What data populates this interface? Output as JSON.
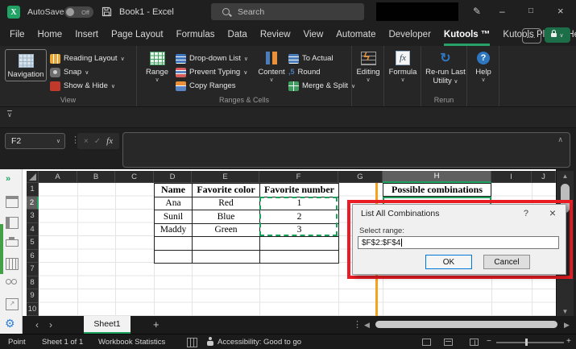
{
  "titlebar": {
    "autosave": "AutoSave",
    "autosave_state": "Off",
    "doc_title": "Book1 - Excel",
    "search_placeholder": "Search"
  },
  "tabs": {
    "items": [
      "File",
      "Home",
      "Insert",
      "Page Layout",
      "Formulas",
      "Data",
      "Review",
      "View",
      "Automate",
      "Developer",
      "Kutools ™",
      "Kutools Plus",
      "Help"
    ],
    "active": "Kutools ™"
  },
  "ribbon": {
    "navigation": "Navigation",
    "reading_layout": "Reading Layout",
    "snap": "Snap",
    "show_hide": "Show & Hide",
    "view_label": "View",
    "range": "Range",
    "dropdown_list": "Drop-down List",
    "prevent_typing": "Prevent Typing",
    "copy_ranges": "Copy Ranges",
    "content": "Content",
    "to_actual": "To Actual",
    "round": "Round",
    "round_icon": ",5",
    "merge_split": "Merge & Split",
    "ranges_cells_label": "Ranges & Cells",
    "editing": "Editing",
    "formula": "Formula",
    "rerun_last": "Re-run Last Utility",
    "rerun_label": "Rerun",
    "help": "Help"
  },
  "formula_bar": {
    "name_box": "F2"
  },
  "sheet": {
    "columns": [
      "A",
      "B",
      "C",
      "D",
      "E",
      "F",
      "G",
      "H",
      "I",
      "J"
    ],
    "rows": [
      "1",
      "2",
      "3",
      "4",
      "5",
      "6",
      "7",
      "8",
      "9",
      "10"
    ],
    "table": {
      "headers": [
        "Name",
        "Favorite color",
        "Favorite number"
      ],
      "rows": [
        [
          "Ana",
          "Red",
          "1"
        ],
        [
          "Sunil",
          "Blue",
          "2"
        ],
        [
          "Maddy",
          "Green",
          "3"
        ]
      ]
    },
    "output_header": "Possible combinations"
  },
  "dialog": {
    "title": "List All Combinations",
    "select_range_label": "Select range:",
    "range_value": "$F$2:$F$4",
    "ok": "OK",
    "cancel": "Cancel"
  },
  "sheet_tabs": {
    "sheet1": "Sheet1"
  },
  "status_bar": {
    "mode": "Point",
    "sheet_info": "Sheet 1 of 1",
    "workbook_statistics": "Workbook Statistics",
    "accessibility": "Accessibility: Good to go"
  },
  "icons": {
    "dropdown": "∨",
    "collapse_up": "∧",
    "collapse_bar": "∨",
    "close": "×",
    "minimize": "–",
    "maximize": "□",
    "pencil": "✎",
    "help_q": "?",
    "cancel_x": "×",
    "check": "✓",
    "fx": "fx",
    "ellipsis": "⋮",
    "chevrons_right": "»",
    "add_sheet": "+",
    "tab_left": "‹",
    "tab_right": "›",
    "scroll_up": "▲",
    "scroll_down": "▼",
    "scroll_left": "◀",
    "scroll_right": "▶",
    "zoom_out": "−",
    "zoom_in": "+",
    "gear": "⚙",
    "rerun_arrow": "↻",
    "external_link": "↗",
    "logo_letter": "X"
  },
  "colors": {
    "excel_green": "#21a366",
    "annotation_red": "#ec1c24",
    "highlight_orange": "#f7a21e",
    "ok_button_border": "#0078d7",
    "marching_ants_green": "#17a25a"
  }
}
